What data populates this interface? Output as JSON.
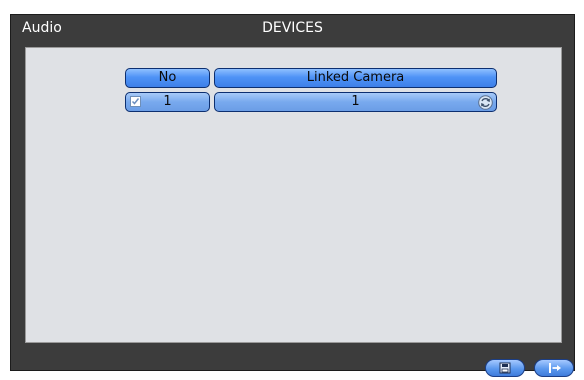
{
  "window": {
    "left_title": "Audio",
    "title": "DEVICES"
  },
  "table": {
    "headers": {
      "no": "No",
      "linked_camera": "Linked Camera"
    },
    "rows": [
      {
        "checked": true,
        "no": "1",
        "linked_camera": "1"
      }
    ]
  },
  "icons": {
    "row_checkbox": "checkbox-checked-icon",
    "linked_camera_action": "refresh-cycle-icon",
    "save_button": "save-disk-icon",
    "exit_button": "exit-arrow-icon"
  },
  "colors": {
    "window_bg": "#3c3c3c",
    "content_bg": "#dfe1e5",
    "header_blue": "#4f93f6",
    "row_blue": "#78a9ee"
  }
}
